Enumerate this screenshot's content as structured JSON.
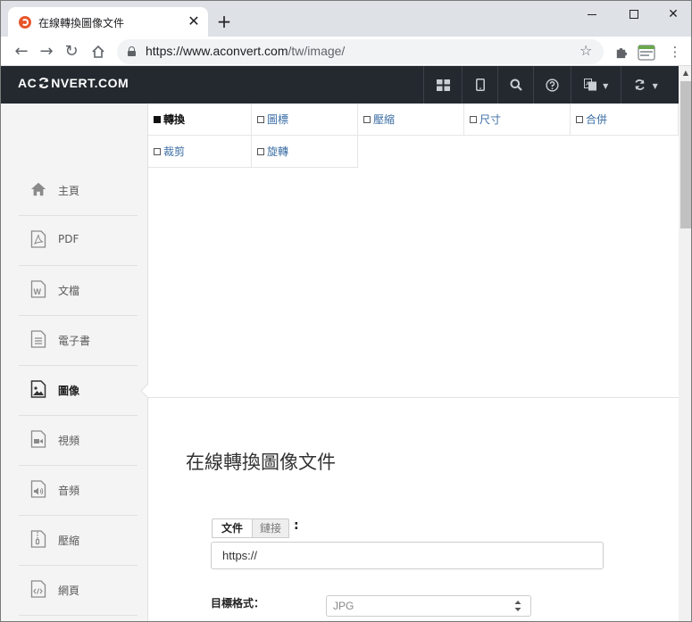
{
  "browser": {
    "tab_title": "在線轉換圖像文件",
    "tab_close": "✕",
    "new_tab": "+",
    "url_host": "https://www.aconvert.com",
    "url_path": "/tw/image/"
  },
  "site": {
    "brand": "AC⟳NVERT.COM",
    "brand_left": "AC",
    "brand_right": "NVERT.COM"
  },
  "tools": [
    {
      "label": "轉換",
      "active": true
    },
    {
      "label": "圖標",
      "active": false
    },
    {
      "label": "壓縮",
      "active": false
    },
    {
      "label": "尺寸",
      "active": false
    },
    {
      "label": "合併",
      "active": false
    },
    {
      "label": "裁剪",
      "active": false
    },
    {
      "label": "旋轉",
      "active": false
    }
  ],
  "sidebar": {
    "items": [
      {
        "label": "主頁",
        "icon": "home-icon"
      },
      {
        "label": "PDF",
        "icon": "pdf-file-icon"
      },
      {
        "label": "文檔",
        "icon": "word-file-icon"
      },
      {
        "label": "電子書",
        "icon": "ebook-file-icon"
      },
      {
        "label": "圖像",
        "icon": "image-file-icon",
        "active": true
      },
      {
        "label": "視頻",
        "icon": "video-file-icon"
      },
      {
        "label": "音頻",
        "icon": "audio-file-icon"
      },
      {
        "label": "壓縮",
        "icon": "archive-file-icon"
      },
      {
        "label": "網頁",
        "icon": "code-file-icon"
      }
    ]
  },
  "main": {
    "title": "在線轉換圖像文件",
    "source_tabs": {
      "file": "文件",
      "link": "鏈接",
      "colon": ":"
    },
    "url_input_value": "https://",
    "format_label": "目標格式：",
    "format_value": "JPG"
  },
  "colors": {
    "navbar": "#23292f",
    "sidebar": "#f4f4f4",
    "link": "#3b6ea5"
  }
}
